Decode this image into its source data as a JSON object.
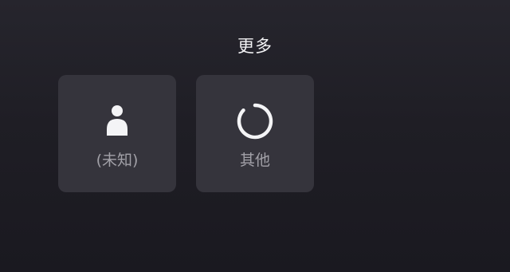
{
  "header": {
    "title": "更多"
  },
  "options": [
    {
      "label": "(未知)",
      "icon": "person-icon"
    },
    {
      "label": "其他",
      "icon": "loading-ring-icon"
    }
  ],
  "colors": {
    "tile_bg": "#35343c",
    "label": "#a2a1a8",
    "icon": "#f4f4f6",
    "title": "#f2f2f4"
  }
}
